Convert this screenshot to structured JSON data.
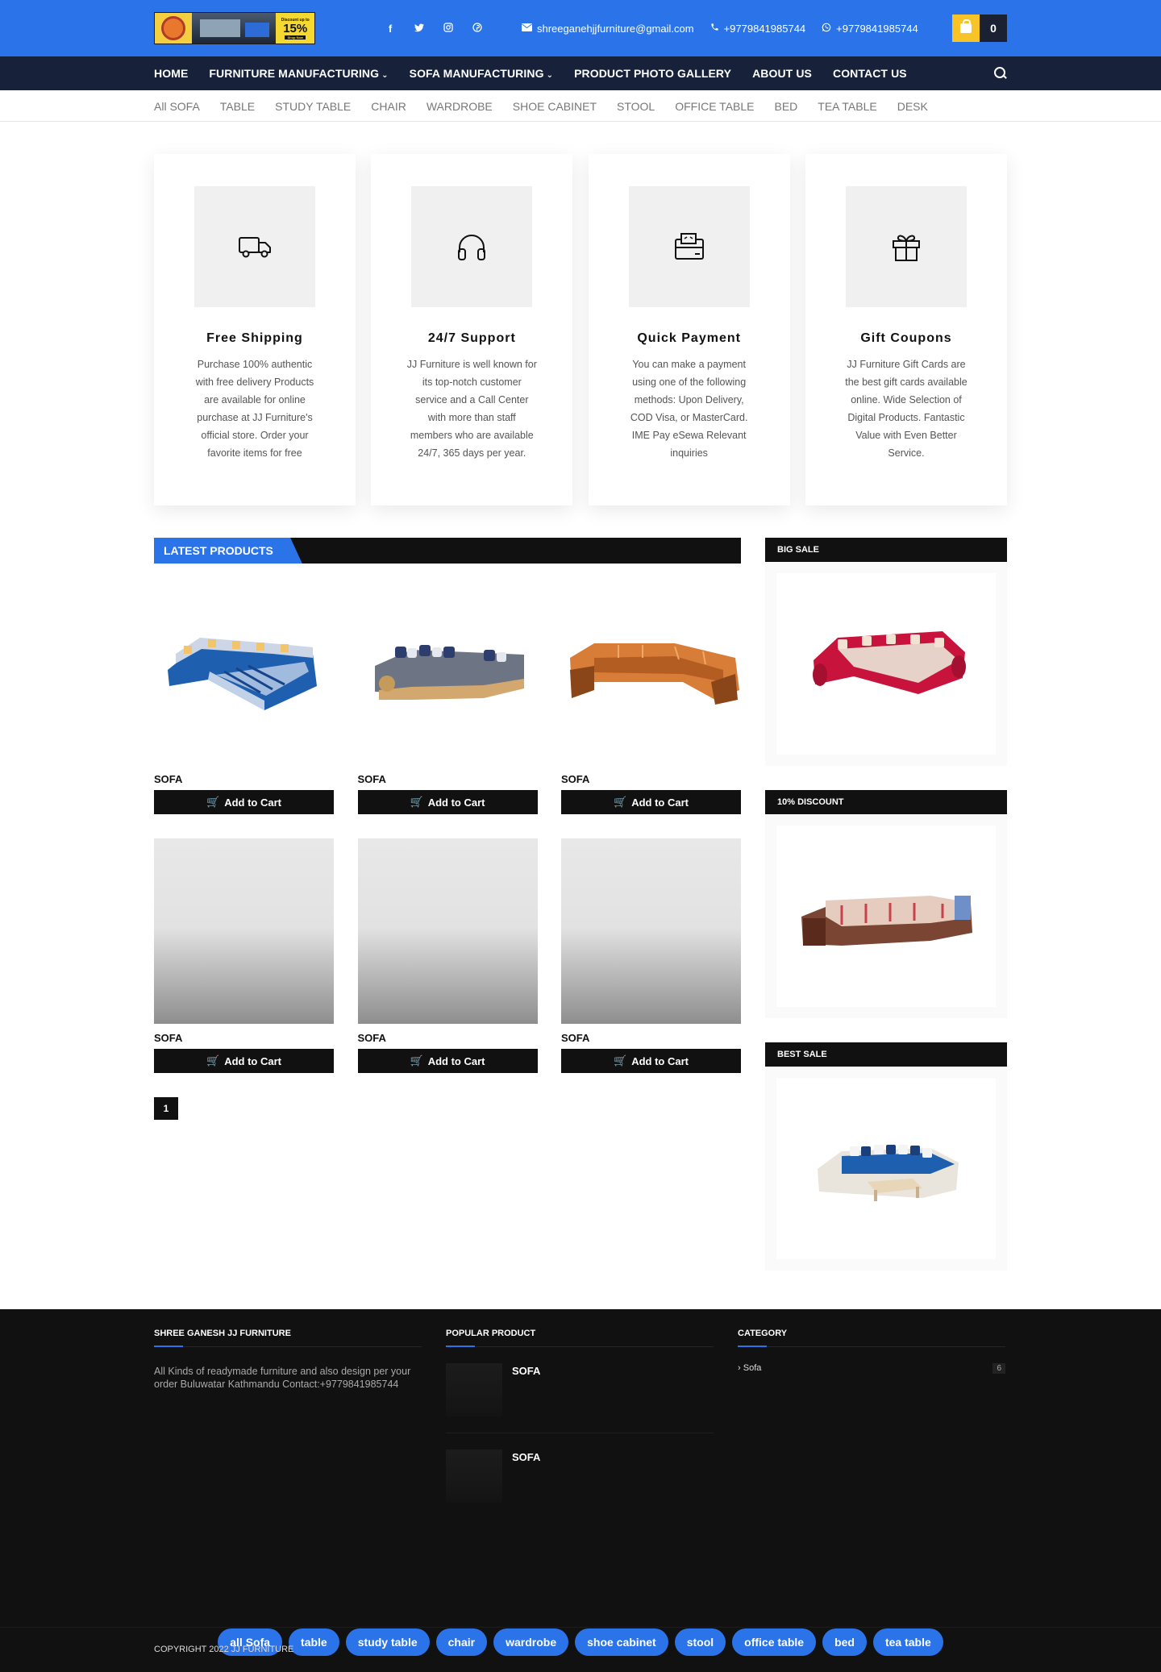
{
  "header": {
    "logo": {
      "badge_small": "Discount up to",
      "badge_big": "15%",
      "badge_btn": "Shop Now"
    },
    "social": [
      "facebook-icon",
      "twitter-icon",
      "instagram-icon",
      "pinterest-icon"
    ],
    "email": "shreeganehjjfurniture@gmail.com",
    "phone": "+9779841985744",
    "whatsapp": "+9779841985744",
    "cart_count": "0"
  },
  "nav": {
    "home": "HOME",
    "furniture": "FURNITURE MANUFACTURING",
    "sofa": "SOFA MANUFACTURING",
    "gallery": "PRODUCT PHOTO GALLERY",
    "about": "ABOUT US",
    "contact": "CONTACT US"
  },
  "subnav": [
    "All SOFA",
    "TABLE",
    "STUDY TABLE",
    "CHAIR",
    "WARDROBE",
    "SHOE CABINET",
    "STOOL",
    "OFFICE TABLE",
    "BED",
    "TEA TABLE",
    "DESK"
  ],
  "features": [
    {
      "title": "Free Shipping",
      "text": "Purchase 100% authentic with free delivery Products are available for online purchase at JJ Furniture's official store. Order your favorite items for free",
      "icon": "truck-icon"
    },
    {
      "title": "24/7 Support",
      "text": "JJ Furniture is well known for its top-notch customer service and a Call Center with more than staff members who are available 24/7, 365 days per year.",
      "icon": "headphones-icon"
    },
    {
      "title": "Quick Payment",
      "text": "You can make a payment using one of the following methods: Upon Delivery, COD Visa, or MasterCard. IME Pay eSewa Relevant inquiries",
      "icon": "wallet-icon"
    },
    {
      "title": "Gift Coupons",
      "text": "JJ Furniture Gift Cards are the best gift cards available online. Wide Selection of Digital Products. Fantastic Value with Even Better Service.",
      "icon": "gift-icon"
    }
  ],
  "latest": {
    "title": "LATEST PRODUCTS",
    "products": [
      {
        "name": "SOFA",
        "button": "Add to Cart"
      },
      {
        "name": "SOFA",
        "button": "Add to Cart"
      },
      {
        "name": "SOFA",
        "button": "Add to Cart"
      },
      {
        "name": "SOFA",
        "button": "Add to Cart"
      },
      {
        "name": "SOFA",
        "button": "Add to Cart"
      },
      {
        "name": "SOFA",
        "button": "Add to Cart"
      }
    ],
    "page": "1"
  },
  "sidebar": {
    "big_sale": "BIG SALE",
    "discount": "10% DISCOUNT",
    "best_sale": "BEST SALE"
  },
  "footer": {
    "about_title": "SHREE GANESH JJ FURNITURE",
    "about_text": "All Kinds of readymade furniture and also design per your order Buluwatar Kathmandu Contact:+9779841985744",
    "popular_title": "POPULAR PRODUCT",
    "popular": [
      "SOFA",
      "SOFA"
    ],
    "category_title": "CATEGORY",
    "category": {
      "name": "Sofa",
      "count": "6"
    },
    "tags": [
      "all Sofa",
      "table",
      "study table",
      "chair",
      "wardrobe",
      "shoe cabinet",
      "stool",
      "office table",
      "bed",
      "tea table"
    ],
    "copyright": "COPYRIGHT 2022 JJ FURNITURE"
  },
  "colors": {
    "accent": "#2b73e8",
    "nav": "#17213a",
    "dark": "#111111",
    "cart": "#f7c326"
  }
}
